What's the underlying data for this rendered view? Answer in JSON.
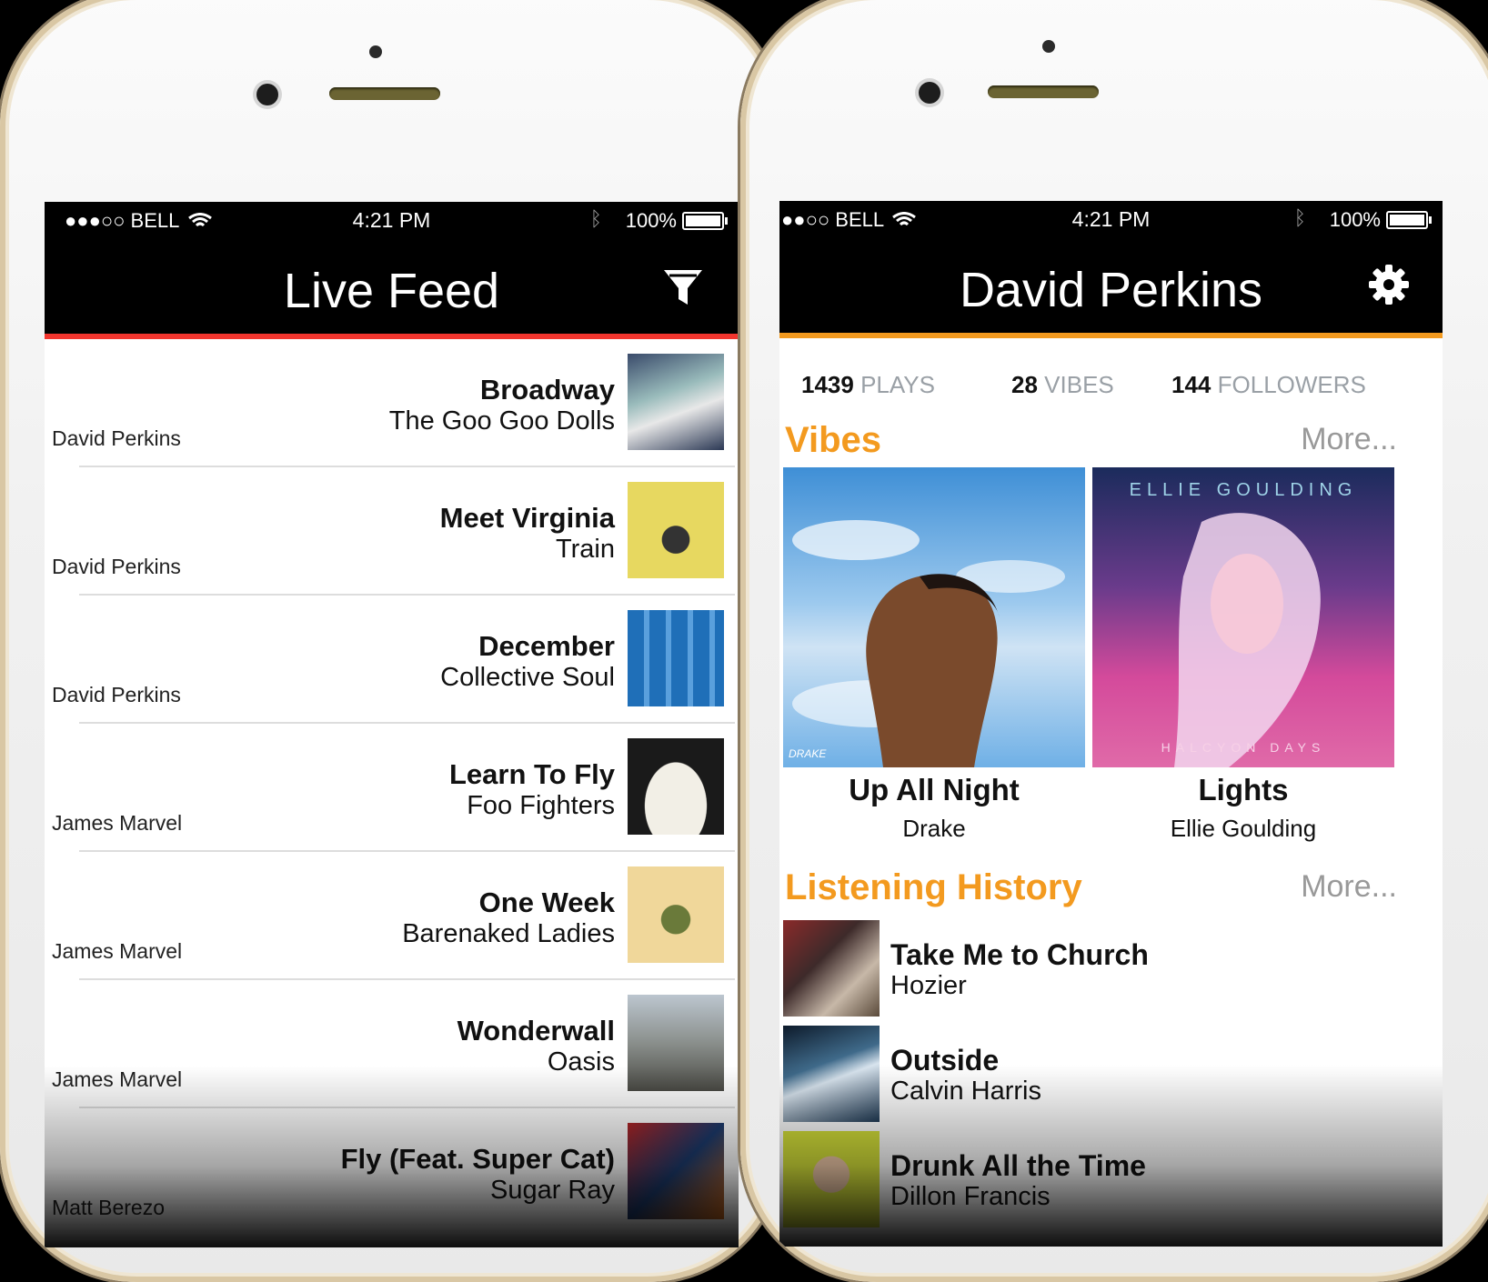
{
  "colors": {
    "left_accent": "#f2352e",
    "right_accent": "#f39a1f",
    "history_heading": "#f39a1f"
  },
  "left_phone": {
    "status": {
      "carrier": "●●●○○ BELL",
      "time": "4:21 PM",
      "battery": "100%"
    },
    "title": "Live Feed",
    "filter_icon": "filter-funnel-icon",
    "feed": [
      {
        "user": "David Perkins",
        "song": "Broadway",
        "artist": "The Goo Goo Dolls",
        "art": "goo-goo-dolls-cover"
      },
      {
        "user": "David Perkins",
        "song": "Meet Virginia",
        "artist": "Train",
        "art": "train-cover"
      },
      {
        "user": "David Perkins",
        "song": "December",
        "artist": "Collective Soul",
        "art": "collective-soul-cover"
      },
      {
        "user": "James Marvel",
        "song": "Learn To Fly",
        "artist": "Foo Fighters",
        "art": "foo-fighters-cover"
      },
      {
        "user": "James Marvel",
        "song": "One Week",
        "artist": "Barenaked Ladies",
        "art": "barenaked-ladies-cover"
      },
      {
        "user": "James Marvel",
        "song": "Wonderwall",
        "artist": "Oasis",
        "art": "oasis-cover"
      },
      {
        "user": "Matt Berezo",
        "song": "Fly (Feat. Super Cat)",
        "artist": "Sugar Ray",
        "art": "sugar-ray-cover"
      }
    ]
  },
  "right_phone": {
    "status": {
      "carrier": "●●○○ BELL",
      "time": "4:21 PM",
      "battery": "100%"
    },
    "title": "David Perkins",
    "settings_icon": "gear-icon",
    "stats": [
      {
        "num": "1439",
        "label": "PLAYS"
      },
      {
        "num": "28",
        "label": "VIBES"
      },
      {
        "num": "144",
        "label": "FOLLOWERS"
      }
    ],
    "vibes": {
      "heading": "Vibes",
      "more": "More...",
      "items": [
        {
          "title": "Up All Night",
          "artist": "Drake",
          "cover_text": "DRAKE"
        },
        {
          "title": "Lights",
          "artist": "Ellie Goulding",
          "cover_top": "ELLIE GOULDING",
          "cover_bottom": "HALCYON DAYS"
        }
      ]
    },
    "history": {
      "heading": "Listening History",
      "more": "More...",
      "items": [
        {
          "title": "Take Me to Church",
          "artist": "Hozier"
        },
        {
          "title": "Outside",
          "artist": "Calvin Harris"
        },
        {
          "title": "Drunk All the Time",
          "artist": "Dillon Francis"
        }
      ]
    }
  }
}
